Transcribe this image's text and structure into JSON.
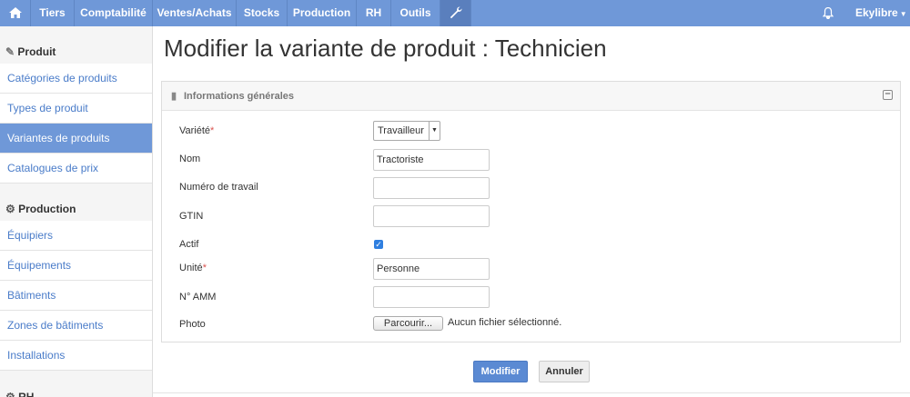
{
  "topnav": {
    "items": [
      "Tiers",
      "Comptabilité",
      "Ventes/Achats",
      "Stocks",
      "Production",
      "RH",
      "Outils"
    ],
    "user": "Ekylibre"
  },
  "sidebar": {
    "section_produit": "Produit",
    "produit_items": [
      "Catégories de produits",
      "Types de produit",
      "Variantes de produits",
      "Catalogues de prix"
    ],
    "section_production": "Production",
    "production_items": [
      "Équipiers",
      "Équipements",
      "Bâtiments",
      "Zones de bâtiments",
      "Installations"
    ],
    "section_rh": "RH"
  },
  "page_title": "Modifier la variante de produit : Technicien",
  "panel": {
    "title": "Informations générales"
  },
  "form": {
    "variete_label": "Variété",
    "variete_value": "Travailleur",
    "nom_label": "Nom",
    "nom_value": "Tractoriste",
    "numero_label": "Numéro de travail",
    "numero_value": "",
    "gtin_label": "GTIN",
    "gtin_value": "",
    "actif_label": "Actif",
    "unite_label": "Unité",
    "unite_value": "Personne",
    "amm_label": "N° AMM",
    "amm_value": "",
    "photo_label": "Photo",
    "browse_label": "Parcourir...",
    "file_status": "Aucun fichier sélectionné.",
    "required_mark": "*"
  },
  "actions": {
    "submit": "Modifier",
    "cancel": "Annuler"
  },
  "colors": {
    "nav_bg": "#6f98d8",
    "link": "#4a7cc9",
    "primary": "#5b8ad3"
  }
}
